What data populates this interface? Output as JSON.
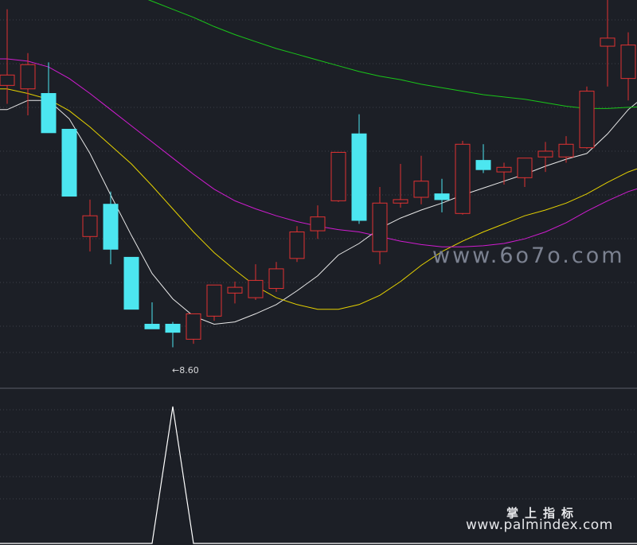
{
  "chart_data": {
    "type": "candlestick",
    "grid": true,
    "candles": [
      {
        "o": 10.87,
        "h": 11.53,
        "l": 10.71,
        "c": 10.96
      },
      {
        "o": 10.84,
        "h": 11.15,
        "l": 10.61,
        "c": 11.05
      },
      {
        "o": 10.8,
        "h": 11.07,
        "l": 10.58,
        "c": 10.46
      },
      {
        "o": 10.49,
        "h": 10.49,
        "l": 9.91,
        "c": 9.91
      },
      {
        "o": 9.56,
        "h": 9.88,
        "l": 9.43,
        "c": 9.74
      },
      {
        "o": 9.84,
        "h": 9.95,
        "l": 9.32,
        "c": 9.45
      },
      {
        "o": 9.38,
        "h": 9.38,
        "l": 8.93,
        "c": 8.93
      },
      {
        "o": 8.8,
        "h": 8.99,
        "l": 8.76,
        "c": 8.76
      },
      {
        "o": 8.8,
        "h": 8.82,
        "l": 8.6,
        "c": 8.73
      },
      {
        "o": 8.67,
        "h": 8.88,
        "l": 8.63,
        "c": 8.89
      },
      {
        "o": 8.87,
        "h": 9.13,
        "l": 8.83,
        "c": 9.14
      },
      {
        "o": 9.07,
        "h": 9.17,
        "l": 8.98,
        "c": 9.12
      },
      {
        "o": 9.03,
        "h": 9.32,
        "l": 9.01,
        "c": 9.18
      },
      {
        "o": 9.11,
        "h": 9.34,
        "l": 9.08,
        "c": 9.28
      },
      {
        "o": 9.37,
        "h": 9.65,
        "l": 9.34,
        "c": 9.6
      },
      {
        "o": 9.61,
        "h": 9.83,
        "l": 9.54,
        "c": 9.73
      },
      {
        "o": 9.87,
        "h": 10.27,
        "l": 9.86,
        "c": 10.29
      },
      {
        "o": 10.45,
        "h": 10.62,
        "l": 9.67,
        "c": 9.7
      },
      {
        "o": 9.43,
        "h": 9.99,
        "l": 9.32,
        "c": 9.85
      },
      {
        "o": 9.85,
        "h": 10.19,
        "l": 9.81,
        "c": 9.88
      },
      {
        "o": 9.9,
        "h": 10.26,
        "l": 9.84,
        "c": 10.04
      },
      {
        "o": 9.93,
        "h": 10.06,
        "l": 9.77,
        "c": 9.88
      },
      {
        "o": 9.76,
        "h": 10.39,
        "l": 9.75,
        "c": 10.36
      },
      {
        "o": 10.22,
        "h": 10.36,
        "l": 10.11,
        "c": 10.14
      },
      {
        "o": 10.12,
        "h": 10.2,
        "l": 10.01,
        "c": 10.16
      },
      {
        "o": 10.07,
        "h": 10.24,
        "l": 9.99,
        "c": 10.24
      },
      {
        "o": 10.25,
        "h": 10.38,
        "l": 10.12,
        "c": 10.3
      },
      {
        "o": 10.25,
        "h": 10.43,
        "l": 10.2,
        "c": 10.36
      },
      {
        "o": 10.33,
        "h": 10.86,
        "l": 10.32,
        "c": 10.82
      },
      {
        "o": 11.21,
        "h": 11.78,
        "l": 10.86,
        "c": 11.28
      },
      {
        "o": 10.93,
        "h": 11.33,
        "l": 10.74,
        "c": 11.22
      }
    ],
    "ma": [
      {
        "color": "#e8e8e8",
        "values": [
          10.66,
          10.74,
          10.74,
          10.58,
          10.28,
          9.92,
          9.57,
          9.24,
          9.02,
          8.87,
          8.8,
          8.82,
          8.89,
          8.97,
          9.09,
          9.22,
          9.4,
          9.5,
          9.63,
          9.72,
          9.79,
          9.85,
          9.92,
          9.98,
          10.04,
          10.1,
          10.17,
          10.23,
          10.28,
          10.45,
          10.66
        ]
      },
      {
        "color": "#e6d200",
        "values": [
          10.84,
          10.8,
          10.75,
          10.65,
          10.51,
          10.35,
          10.19,
          10.0,
          9.8,
          9.6,
          9.42,
          9.27,
          9.13,
          9.03,
          8.97,
          8.93,
          8.93,
          8.97,
          9.05,
          9.17,
          9.31,
          9.43,
          9.52,
          9.6,
          9.67,
          9.74,
          9.79,
          9.85,
          9.93,
          10.03,
          10.12
        ]
      },
      {
        "color": "#d01cd0",
        "values": [
          11.1,
          11.08,
          11.03,
          10.93,
          10.8,
          10.66,
          10.52,
          10.38,
          10.24,
          10.1,
          9.97,
          9.87,
          9.8,
          9.74,
          9.69,
          9.65,
          9.62,
          9.6,
          9.56,
          9.52,
          9.49,
          9.47,
          9.47,
          9.48,
          9.5,
          9.54,
          9.6,
          9.68,
          9.78,
          9.87,
          9.95
        ]
      },
      {
        "color": "#19c519",
        "values": [
          11.9,
          11.88,
          11.86,
          11.83,
          11.79,
          11.74,
          11.67,
          11.6,
          11.53,
          11.46,
          11.38,
          11.31,
          11.25,
          11.19,
          11.14,
          11.09,
          11.04,
          10.99,
          10.95,
          10.92,
          10.88,
          10.85,
          10.82,
          10.79,
          10.77,
          10.75,
          10.72,
          10.69,
          10.67,
          10.67,
          10.68
        ]
      }
    ],
    "low_marker": "8.60",
    "indicator": {
      "values": [
        0,
        0,
        0,
        0,
        0,
        0,
        0,
        0,
        1,
        0,
        0,
        0,
        0,
        0,
        0,
        0,
        0,
        0,
        0,
        0,
        0,
        0,
        0,
        0,
        0,
        0,
        0,
        0,
        0,
        0,
        0
      ],
      "color": "#ffffff"
    },
    "colors": {
      "up": "#e03232",
      "down": "#4ce6f0",
      "grid": "#3b3f48",
      "background": "#1c1f26"
    }
  },
  "watermark": {
    "site1": "www.6o7o.com",
    "cn": "掌上指标",
    "site2": "www.palmindex.com"
  }
}
